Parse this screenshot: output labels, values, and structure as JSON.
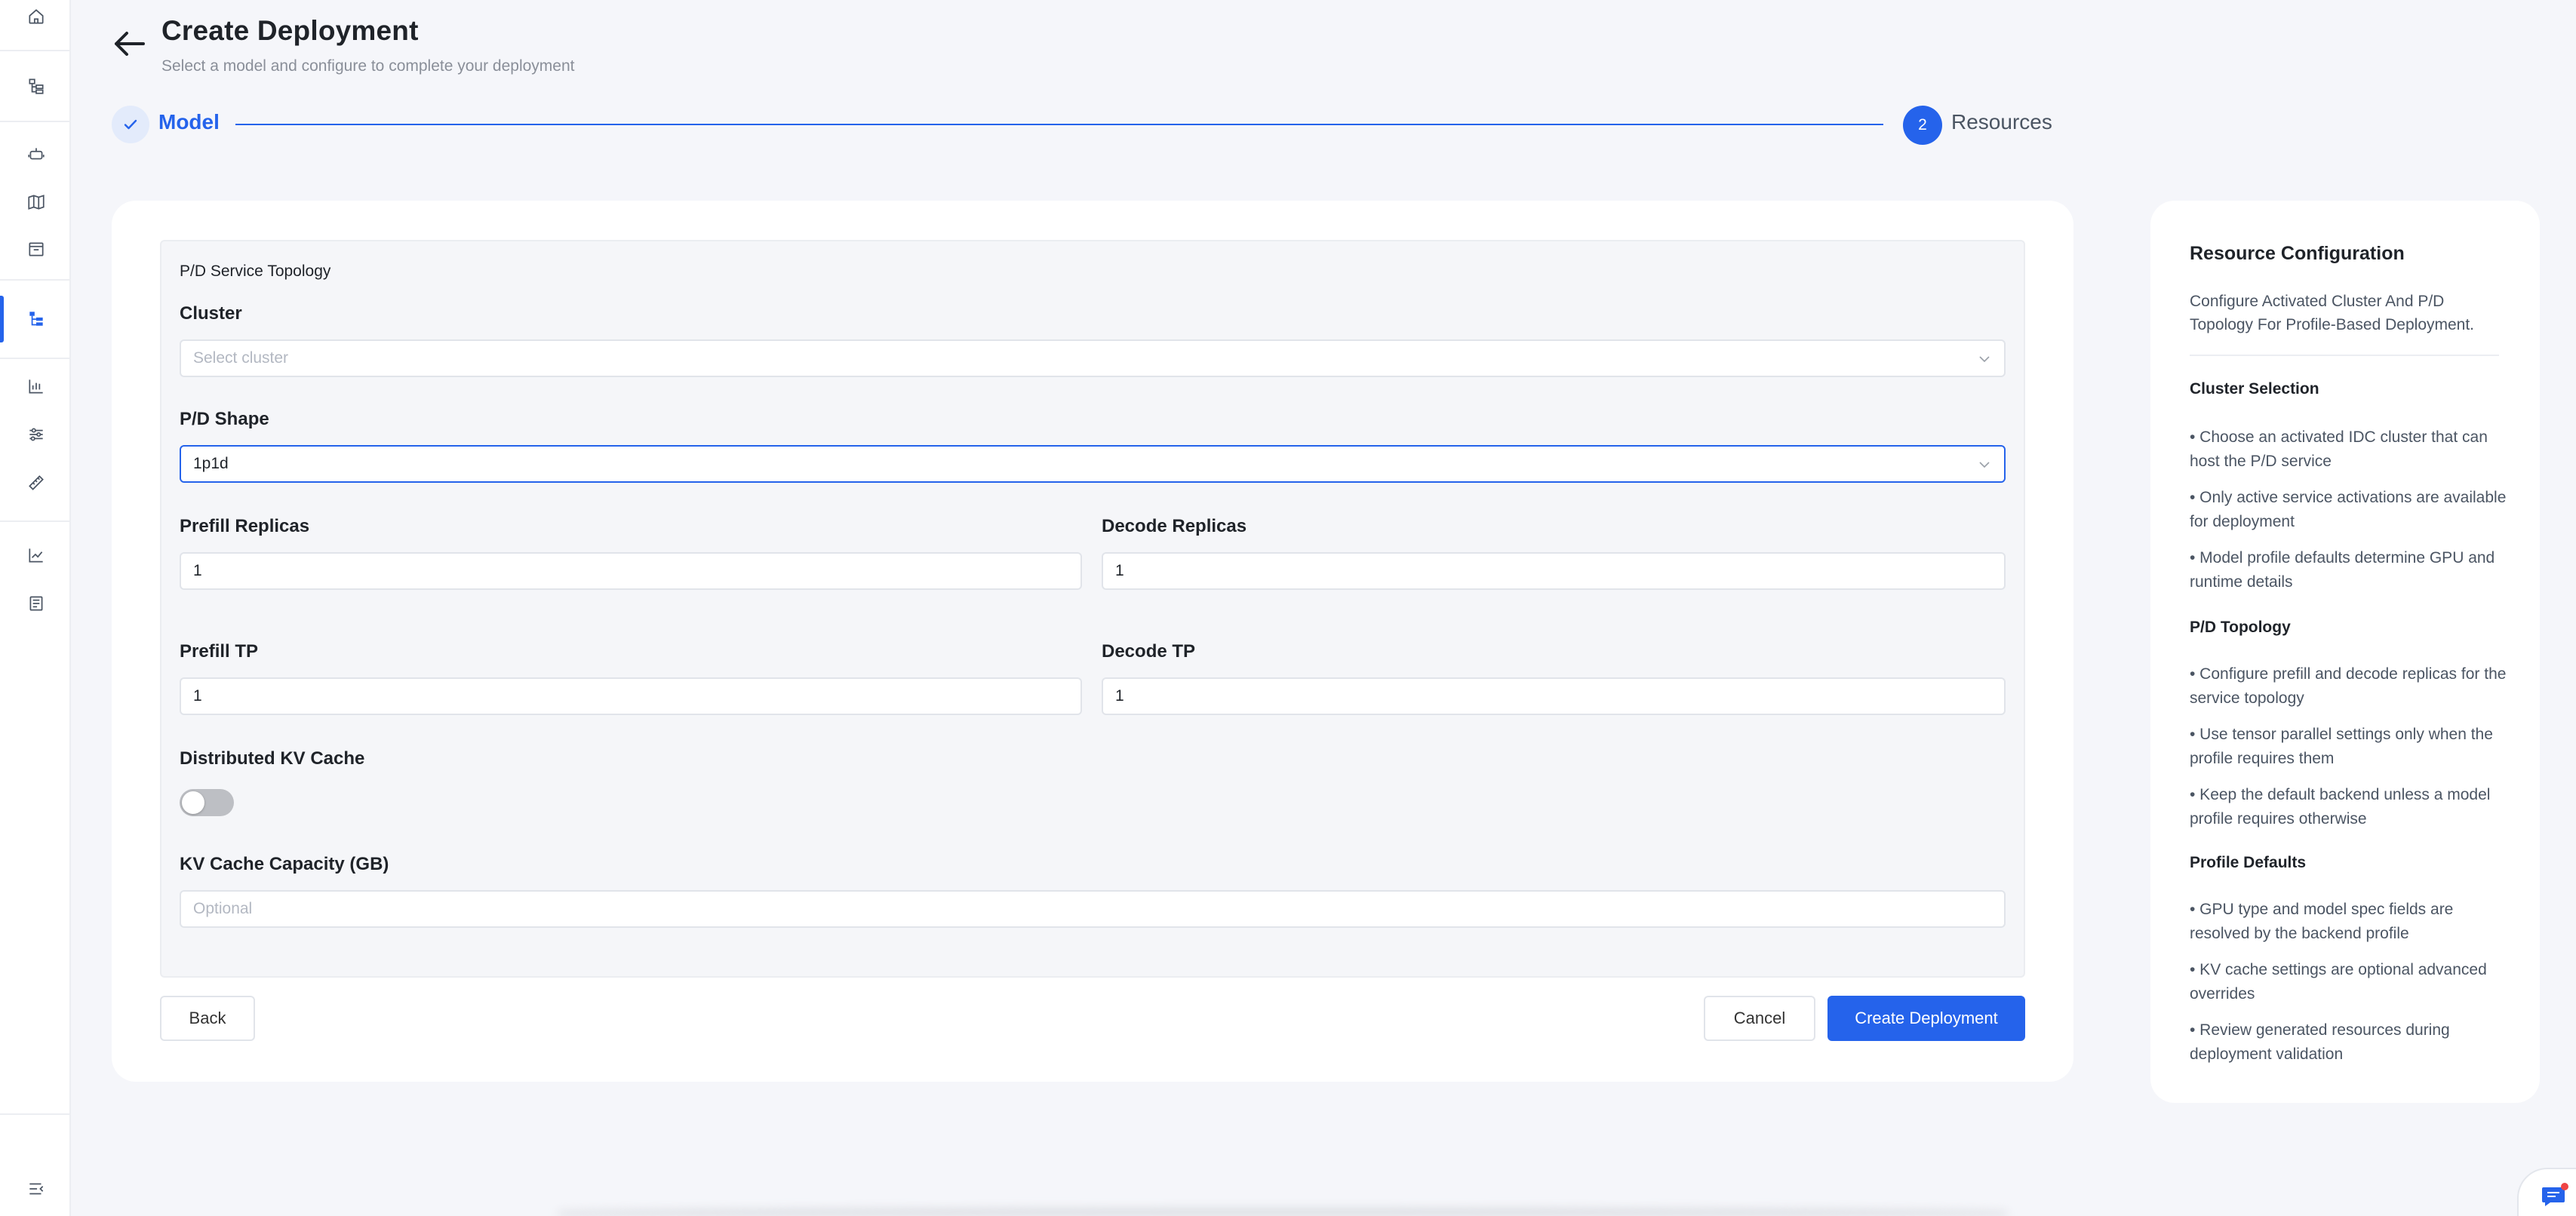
{
  "header": {
    "title": "Create Deployment",
    "subtitle": "Select a model and configure to complete your deployment"
  },
  "stepper": {
    "step1_label": "Model",
    "step2_number": "2",
    "step2_label": "Resources"
  },
  "form": {
    "section_title": "P/D Service Topology",
    "cluster_label": "Cluster",
    "cluster_placeholder": "Select cluster",
    "pd_shape_label": "P/D Shape",
    "pd_shape_value": "1p1d",
    "prefill_replicas_label": "Prefill Replicas",
    "prefill_replicas_value": "1",
    "decode_replicas_label": "Decode Replicas",
    "decode_replicas_value": "1",
    "prefill_tp_label": "Prefill TP",
    "prefill_tp_value": "1",
    "decode_tp_label": "Decode TP",
    "decode_tp_value": "1",
    "distributed_kv_label": "Distributed KV Cache",
    "distributed_kv_enabled": false,
    "kv_capacity_label": "KV Cache Capacity (GB)",
    "kv_capacity_placeholder": "Optional"
  },
  "actions": {
    "back": "Back",
    "cancel": "Cancel",
    "create": "Create Deployment"
  },
  "panel": {
    "title": "Resource Configuration",
    "description": "Configure Activated Cluster And P/D Topology For Profile-Based Deployment.",
    "sections": [
      {
        "heading": "Cluster Selection",
        "items": [
          "• Choose an activated IDC cluster that can host the P/D service",
          "• Only active service activations are available for deployment",
          "• Model profile defaults determine GPU and runtime details"
        ]
      },
      {
        "heading": "P/D Topology",
        "items": [
          "• Configure prefill and decode replicas for the service topology",
          "• Use tensor parallel settings only when the profile requires them",
          "• Keep the default backend unless a model profile requires otherwise"
        ]
      },
      {
        "heading": "Profile Defaults",
        "items": [
          "• GPU type and model spec fields are resolved by the backend profile",
          "• KV cache settings are optional advanced overrides",
          "• Review generated resources during deployment validation"
        ]
      }
    ]
  },
  "colors": {
    "accent": "#2563eb",
    "background": "#f5f6fa",
    "toggle_off": "#bdbfc4"
  },
  "sidebar": {
    "icons": [
      "home-icon",
      "hierarchy-icon",
      "robot-icon",
      "map-icon",
      "box-icon",
      "deployment-icon",
      "bar-chart-icon",
      "sliders-icon",
      "ruler-icon",
      "line-chart-icon",
      "list-icon",
      "collapse-menu-icon"
    ],
    "active": "deployment-icon"
  }
}
